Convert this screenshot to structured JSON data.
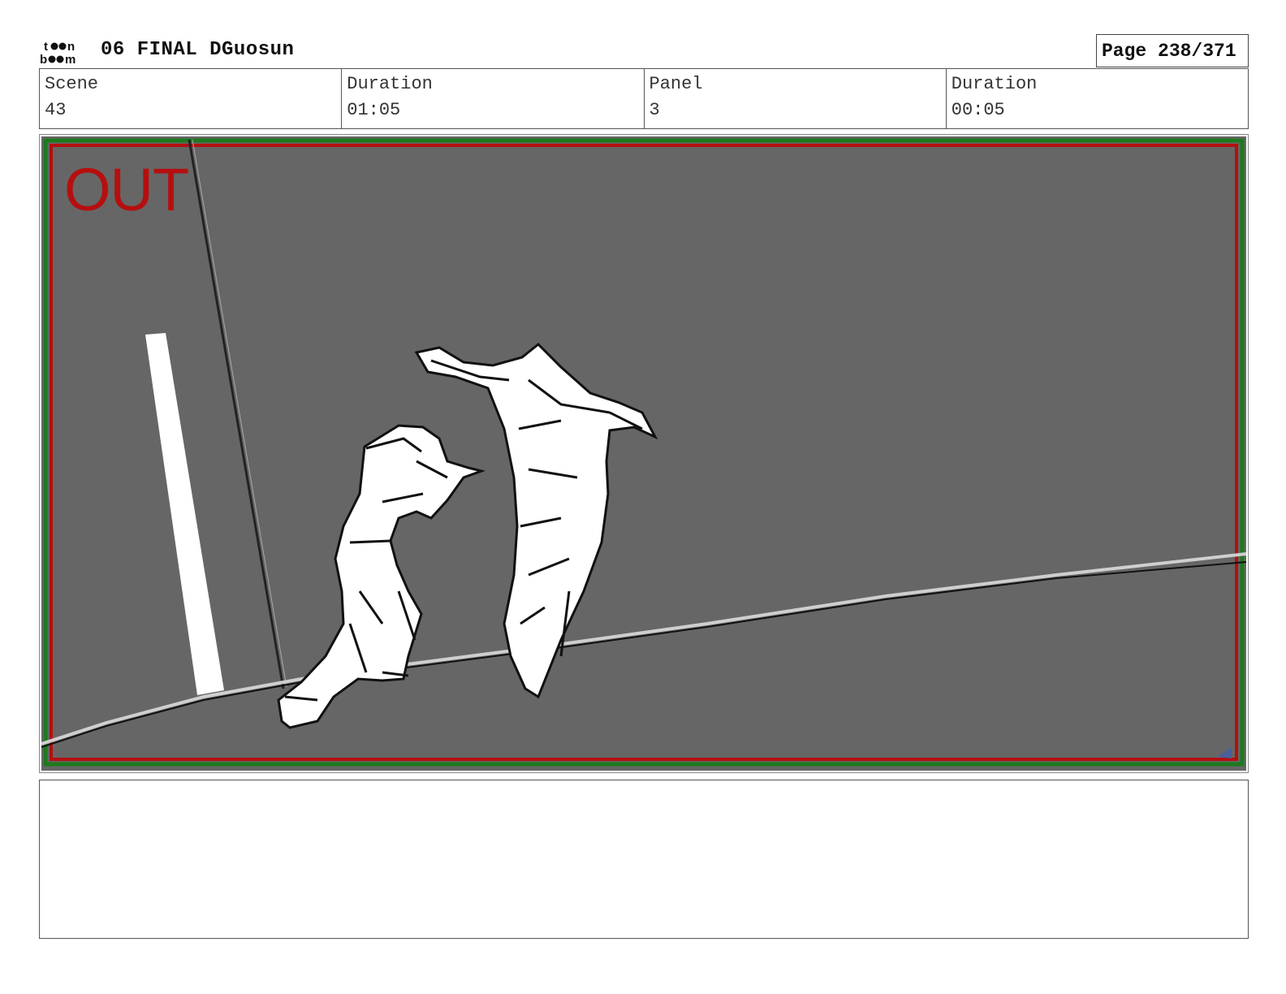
{
  "header": {
    "logo_icon": "toon-boom-logo",
    "title": "06 FINAL DGuosun",
    "page": "Page 238/371"
  },
  "info": {
    "scene_label": "Scene",
    "scene_value": "43",
    "scene_duration_label": "Duration",
    "scene_duration_value": "01:05",
    "panel_label": "Panel",
    "panel_value": "3",
    "panel_duration_label": "Duration",
    "panel_duration_value": "00:05"
  },
  "panel": {
    "overlay_label": "OUT",
    "background_color": "#666666",
    "frame_color": "#b50f0f",
    "safe_frame_color": "#1d7a1d"
  },
  "notes": {
    "text": ""
  }
}
